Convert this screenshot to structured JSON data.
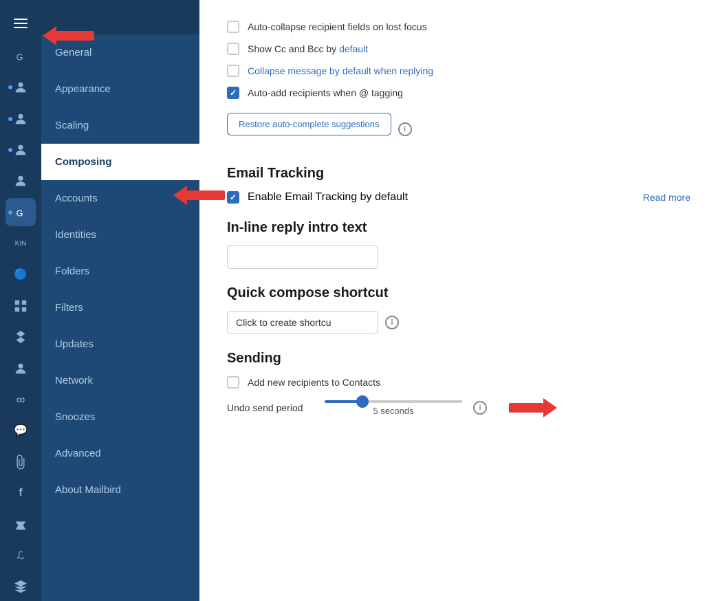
{
  "iconBar": {
    "icons": [
      {
        "name": "account-icon-1",
        "label": "G",
        "active": false,
        "dot": false
      },
      {
        "name": "account-icon-2",
        "label": "person",
        "active": false,
        "dot": true
      },
      {
        "name": "account-icon-3",
        "label": "person2",
        "active": false,
        "dot": true
      },
      {
        "name": "account-icon-4",
        "label": "person3",
        "active": false,
        "dot": true
      },
      {
        "name": "account-icon-5",
        "label": "person4",
        "active": false,
        "dot": false
      },
      {
        "name": "account-icon-6",
        "label": "G2",
        "active": true,
        "dot": true
      }
    ]
  },
  "sidebar": {
    "items": [
      {
        "id": "general",
        "label": "General",
        "active": false
      },
      {
        "id": "appearance",
        "label": "Appearance",
        "active": false
      },
      {
        "id": "scaling",
        "label": "Scaling",
        "active": false
      },
      {
        "id": "composing",
        "label": "Composing",
        "active": true
      },
      {
        "id": "accounts",
        "label": "Accounts",
        "active": false
      },
      {
        "id": "identities",
        "label": "Identities",
        "active": false
      },
      {
        "id": "folders",
        "label": "Folders",
        "active": false
      },
      {
        "id": "filters",
        "label": "Filters",
        "active": false
      },
      {
        "id": "updates",
        "label": "Updates",
        "active": false
      },
      {
        "id": "network",
        "label": "Network",
        "active": false
      },
      {
        "id": "snoozes",
        "label": "Snoozes",
        "active": false
      },
      {
        "id": "advanced",
        "label": "Advanced",
        "active": false
      },
      {
        "id": "about",
        "label": "About Mailbird",
        "active": false
      }
    ]
  },
  "main": {
    "checkboxes": [
      {
        "id": "auto-collapse",
        "label": "Auto-collapse recipient fields on lost focus",
        "checked": false
      },
      {
        "id": "show-cc-bcc",
        "label_prefix": "Show Cc and Bcc by ",
        "label_link": "default",
        "checked": false
      },
      {
        "id": "collapse-message",
        "label": "Collapse message by default when replying",
        "checked": false,
        "label_colored": true
      },
      {
        "id": "auto-add",
        "label": "Auto-add recipients when @ tagging",
        "checked": true
      }
    ],
    "restoreButton": "Restore auto-complete suggestions",
    "emailTracking": {
      "title": "Email Tracking",
      "checkbox": {
        "label": "Enable Email Tracking by default",
        "checked": true
      },
      "readMore": "Read more"
    },
    "inlineReply": {
      "title": "In-line reply intro text",
      "placeholder": ""
    },
    "quickCompose": {
      "title": "Quick compose shortcut",
      "placeholder": "Click to create shortcu"
    },
    "sending": {
      "title": "Sending",
      "addRecipients": {
        "label": "Add new recipients to Contacts",
        "checked": false
      },
      "undoSend": {
        "label": "Undo send period",
        "value": "5 seconds",
        "sliderPosition": 25
      }
    }
  }
}
